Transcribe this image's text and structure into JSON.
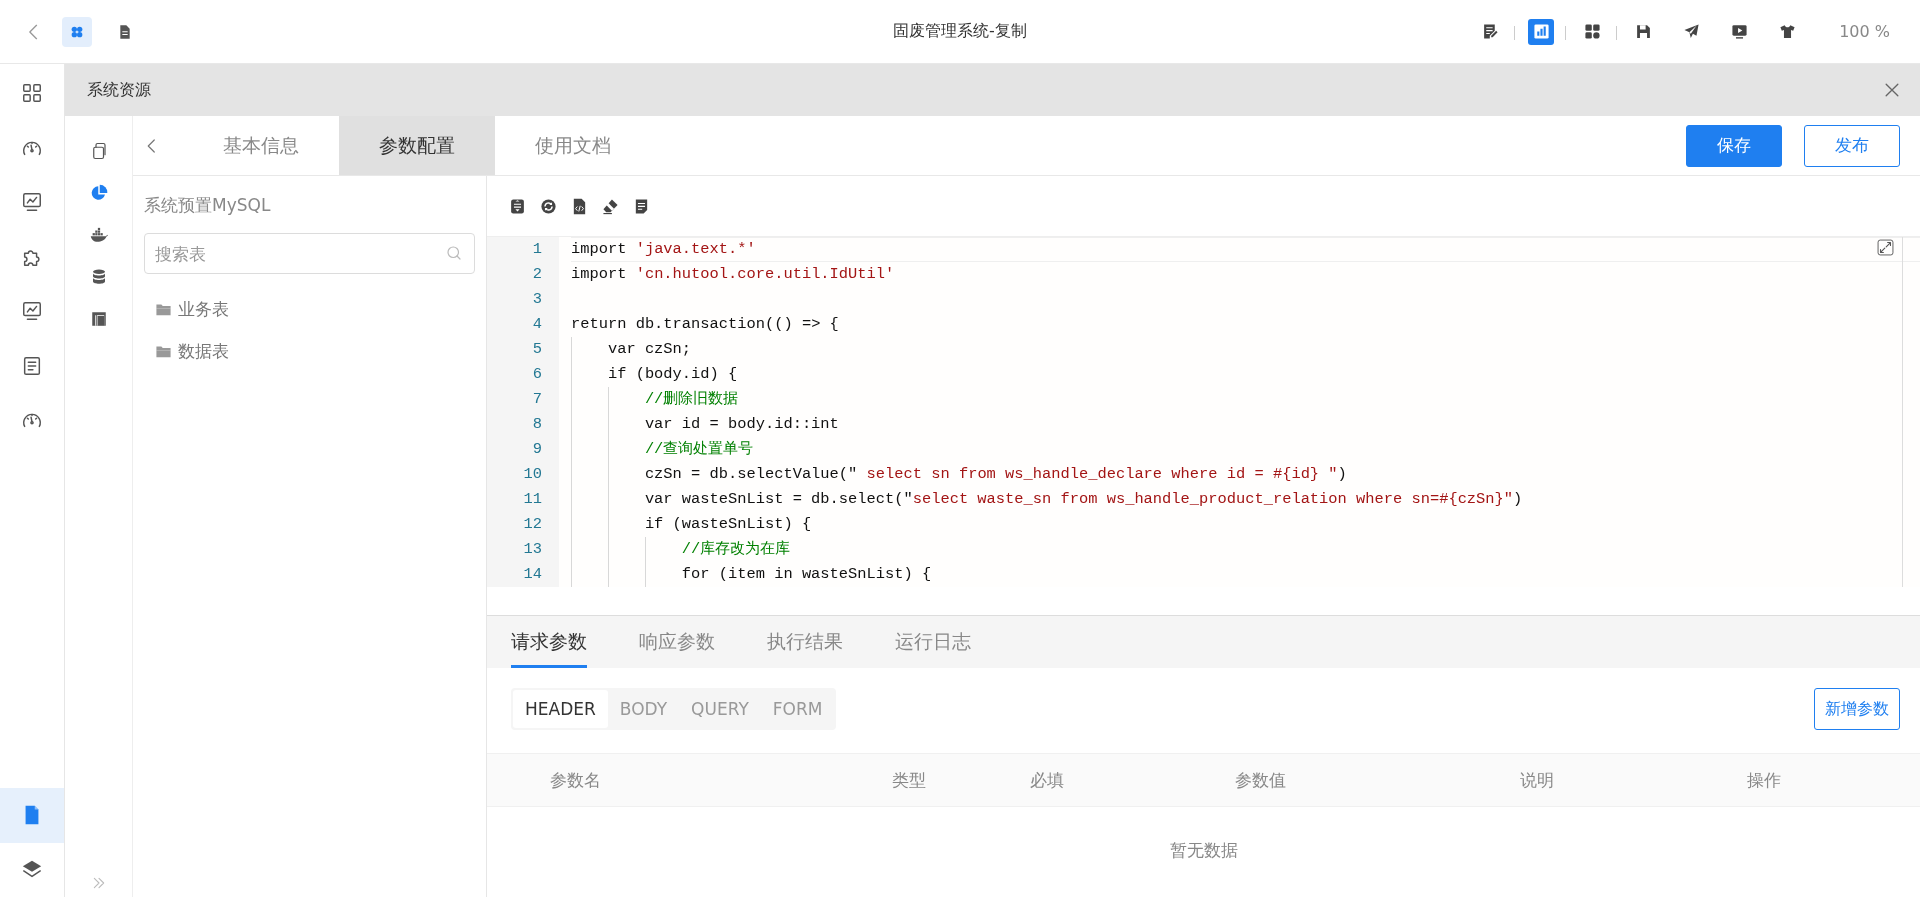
{
  "top_bar": {
    "left_tools": [
      {
        "selected": true
      },
      {
        "selected": false
      }
    ],
    "title": "固废管理系统-复制",
    "right_tools": [
      {
        "selected": false
      },
      {
        "selected": true
      },
      {
        "selected": false
      },
      {
        "selected": false
      },
      {
        "selected": false
      },
      {
        "selected": false
      },
      {
        "selected": false
      }
    ],
    "zoom": "100 %"
  },
  "rail": {
    "items": [
      {
        "selected": false
      },
      {
        "selected": false
      },
      {
        "selected": false
      },
      {
        "selected": false
      },
      {
        "selected": false
      },
      {
        "selected": false
      },
      {
        "selected": false
      }
    ],
    "bottom_items": [
      {
        "selected": true
      },
      {
        "selected": false
      }
    ]
  },
  "panel": {
    "title": "系统资源"
  },
  "side_tools": [
    {
      "selected": false
    },
    {
      "selected": true
    },
    {
      "selected": false
    },
    {
      "selected": false
    },
    {
      "selected": false
    }
  ],
  "tabs": [
    {
      "label": "基本信息",
      "selected": false
    },
    {
      "label": "参数配置",
      "selected": true
    },
    {
      "label": "使用文档",
      "selected": false
    }
  ],
  "actions": [
    {
      "label": "保存",
      "kind": "primary"
    },
    {
      "label": "发布",
      "kind": "outline"
    }
  ],
  "datasource": {
    "title": "系统预置MySQL",
    "search": {
      "placeholder": "搜索表"
    },
    "folders": [
      {
        "label": "业务表"
      },
      {
        "label": "数据表"
      }
    ]
  },
  "editor": {
    "lines": [
      {
        "number": "1",
        "tokens": [
          {
            "kind": "plain",
            "text": "import "
          },
          {
            "kind": "string",
            "text": "'java.text.*'"
          }
        ]
      },
      {
        "number": "2",
        "tokens": [
          {
            "kind": "plain",
            "text": "import "
          },
          {
            "kind": "string",
            "text": "'cn.hutool.core.util.IdUtil'"
          }
        ]
      },
      {
        "number": "3"
      },
      {
        "number": "4",
        "tokens": [
          {
            "kind": "plain",
            "text": "return db.transaction(() => {"
          }
        ]
      },
      {
        "number": "5",
        "tokens": [
          {
            "kind": "plain",
            "text": "    var czSn;"
          }
        ]
      },
      {
        "number": "6",
        "tokens": [
          {
            "kind": "plain",
            "text": "    if (body.id) {"
          }
        ]
      },
      {
        "number": "7",
        "tokens": [
          {
            "kind": "comment",
            "text": "        //删除旧数据"
          }
        ]
      },
      {
        "number": "8",
        "tokens": [
          {
            "kind": "plain",
            "text": "        var id = body.id::int"
          }
        ]
      },
      {
        "number": "9",
        "tokens": [
          {
            "kind": "comment",
            "text": "        //查询处置单号"
          }
        ]
      },
      {
        "number": "10",
        "tokens": [
          {
            "kind": "plain",
            "text": "        czSn = db.selectValue(\""
          },
          {
            "kind": "string",
            "text": " select sn from ws_handle_declare where id = #{id} \""
          },
          {
            "kind": "plain",
            "text": ")"
          }
        ]
      },
      {
        "number": "11",
        "tokens": [
          {
            "kind": "plain",
            "text": "        var wasteSnList = db.select(\""
          },
          {
            "kind": "string",
            "text": "select waste_sn from ws_handle_product_relation where sn=#{czSn}\""
          },
          {
            "kind": "plain",
            "text": ")"
          }
        ]
      },
      {
        "number": "12",
        "tokens": [
          {
            "kind": "plain",
            "text": "        if (wasteSnList) {"
          }
        ]
      },
      {
        "number": "13",
        "tokens": [
          {
            "kind": "comment",
            "text": "            //库存改为在库"
          }
        ]
      },
      {
        "number": "14",
        "tokens": [
          {
            "kind": "plain",
            "text": "            for (item in wasteSnList) {"
          }
        ]
      }
    ]
  },
  "bottom_tabs": [
    {
      "label": "请求参数",
      "selected": true
    },
    {
      "label": "响应参数",
      "selected": false
    },
    {
      "label": "执行结果",
      "selected": false
    },
    {
      "label": "运行日志",
      "selected": false
    }
  ],
  "sub_tabs": [
    {
      "label": "HEADER",
      "selected": true
    },
    {
      "label": "BODY",
      "selected": false
    },
    {
      "label": "QUERY",
      "selected": false
    },
    {
      "label": "FORM",
      "selected": false
    }
  ],
  "add_button": "新增参数",
  "table": {
    "columns": [
      "参数名",
      "类型",
      "必填",
      "参数值",
      "说明",
      "操作"
    ],
    "empty": "暂无数据"
  }
}
